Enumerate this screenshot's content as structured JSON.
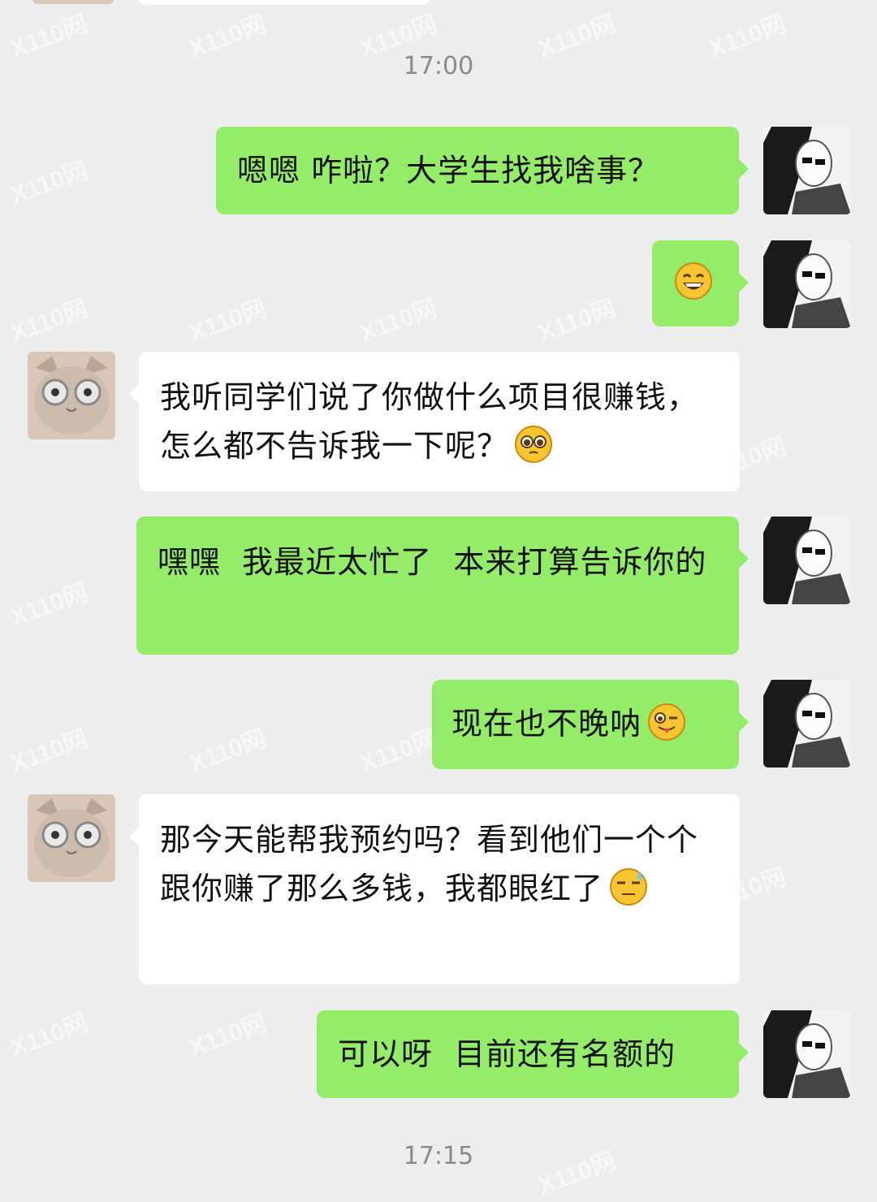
{
  "timestamps": {
    "first": "17:00",
    "second": "17:15"
  },
  "watermark_text": "X110网",
  "messages": [
    {
      "side": "me",
      "text": "嗯嗯 咋啦？大学生找我啥事？"
    },
    {
      "side": "me",
      "emoji": "grinning-face-emoji"
    },
    {
      "side": "them",
      "text": "我听同学们说了你做什么项目很赚钱，怎么都不告诉我一下呢？",
      "emoji": "pleading-face-emoji"
    },
    {
      "side": "me",
      "text": "嘿嘿  我最近太忙了  本来打算告诉你的"
    },
    {
      "side": "me",
      "text": "现在也不晚呐",
      "emoji": "winking-tongue-emoji"
    },
    {
      "side": "them",
      "text": "那今天能帮我预约吗？看到他们一个个跟你赚了那么多钱，我都眼红了",
      "emoji": "sweat-face-emoji"
    },
    {
      "side": "me",
      "text": "可以呀  目前还有名额的"
    }
  ],
  "colors": {
    "my_bubble": "#95ec69",
    "their_bubble": "#ffffff",
    "background": "#ededed"
  }
}
